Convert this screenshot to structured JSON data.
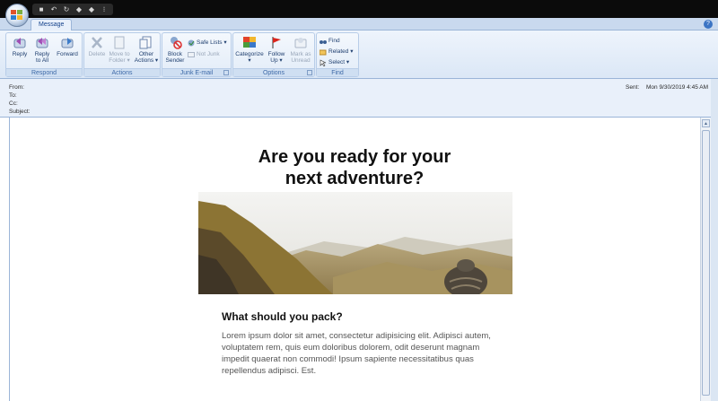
{
  "quick_access": [
    "save",
    "undo",
    "redo",
    "previous",
    "next",
    "customize"
  ],
  "tabs": [
    {
      "label": "Message",
      "active": true
    }
  ],
  "ribbon": {
    "groups": {
      "respond": "Respond",
      "actions": "Actions",
      "junk": "Junk E-mail",
      "options": "Options",
      "find": "Find"
    },
    "buttons": {
      "reply": "Reply",
      "reply_all": "Reply\nto All",
      "forward": "Forward",
      "delete": "Delete",
      "move_to_folder": "Move to\nFolder ▾",
      "other_actions": "Other\nActions ▾",
      "block_sender": "Block\nSender",
      "safe_lists": "Safe Lists ▾",
      "not_junk": "Not Junk",
      "categorize": "Categorize\n▾",
      "follow_up": "Follow\nUp ▾",
      "mark_as_unread": "Mark as\nUnread",
      "find": "Find",
      "related": "Related ▾",
      "select": "Select ▾"
    }
  },
  "header": {
    "from_label": "From:",
    "to_label": "To:",
    "cc_label": "Cc:",
    "subject_label": "Subject:",
    "sent_label": "Sent:",
    "sent_value": "Mon 9/30/2019 4:45 AM"
  },
  "email": {
    "headline_line1": "Are you ready for your",
    "headline_line2": "next adventure?",
    "section_title": "What should you pack?",
    "paragraph": "Lorem ipsum dolor sit amet, consectetur adipisicing elit. Adipisci autem, voluptatem rem, quis eum doloribus dolorem, odit deserunt magnam impedit quaerat non commodi! Ipsum sapiente necessitatibus quas repellendus adipisci. Est."
  },
  "colors": {
    "ribbon_bg": "#dbe7f6",
    "accent": "#3e6aa8",
    "title_bar": "#0b0b0b"
  }
}
